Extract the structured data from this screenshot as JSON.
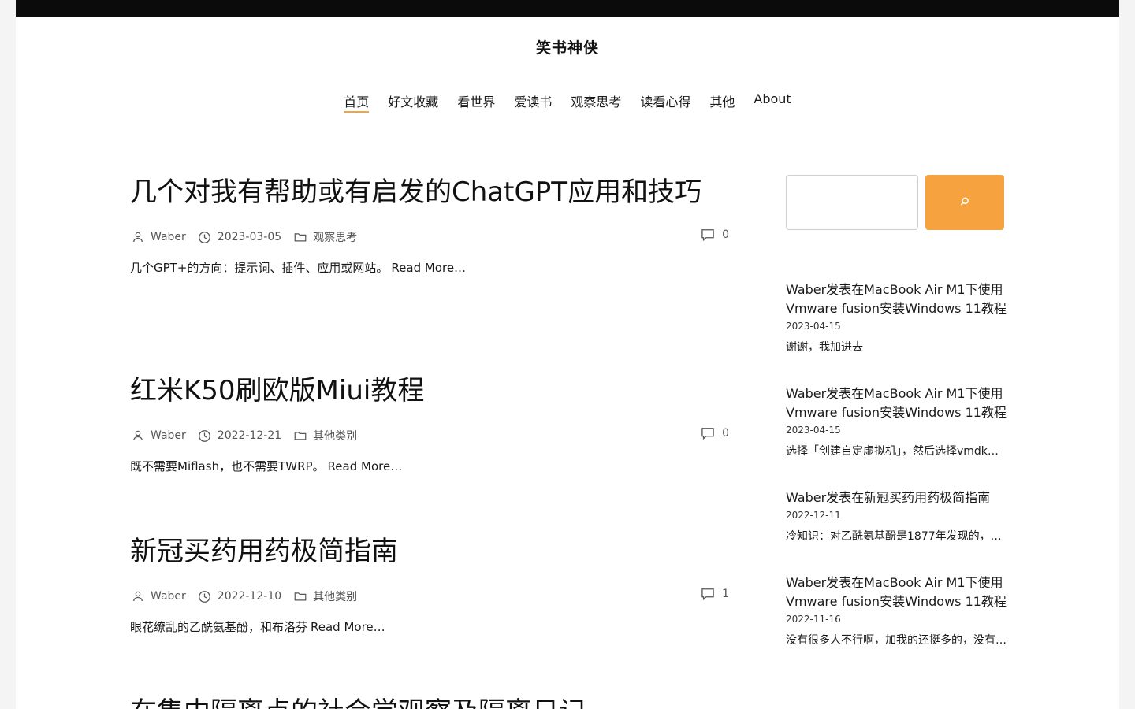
{
  "site": {
    "title": "笑书神侠"
  },
  "nav": [
    {
      "label": "首页",
      "active": true
    },
    {
      "label": "好文收藏"
    },
    {
      "label": "看世界"
    },
    {
      "label": "爱读书"
    },
    {
      "label": "观察思考"
    },
    {
      "label": "读看心得"
    },
    {
      "label": "其他"
    },
    {
      "label": "About"
    }
  ],
  "posts": [
    {
      "title": "几个对我有帮助或有启发的ChatGPT应用和技巧",
      "author": "Waber",
      "date": "2023-03-05",
      "category": "观察思考",
      "comments": "0",
      "excerpt": "几个GPT+的方向：提示词、插件、应用或网站。",
      "read_more": "Read More…"
    },
    {
      "title": "红米K50刷欧版Miui教程",
      "author": "Waber",
      "date": "2022-12-21",
      "category": "其他类别",
      "comments": "0",
      "excerpt": "既不需要Miflash，也不需要TWRP。",
      "read_more": "Read More…"
    },
    {
      "title": "新冠买药用药极简指南",
      "author": "Waber",
      "date": "2022-12-10",
      "category": "其他类别",
      "comments": "1",
      "excerpt": "眼花缭乱的乙酰氨基酚，和布洛芬",
      "read_more": "Read More…"
    },
    {
      "title": "在集中隔离点的社会学观察及隔离日记",
      "author": "",
      "date": "",
      "category": "",
      "comments": "",
      "excerpt": "",
      "read_more": ""
    }
  ],
  "sidebar": {
    "search_placeholder": "",
    "recent_comments": [
      {
        "head": "Waber发表在MacBook Air M1下使用Vmware fusion安装Windows 11教程",
        "date": "2023-04-15",
        "text": "谢谢，我加进去"
      },
      {
        "head": "Waber发表在MacBook Air M1下使用Vmware fusion安装Windows 11教程",
        "date": "2023-04-15",
        "text": "选择「创建自定虚拟机」，然后选择vmdk…"
      },
      {
        "head": "Waber发表在新冠买药用药极简指南",
        "date": "2022-12-11",
        "text": "冷知识：对乙酰氨基酚是1877年发现的，…"
      },
      {
        "head": "Waber发表在MacBook Air M1下使用Vmware fusion安装Windows 11教程",
        "date": "2022-11-16",
        "text": "没有很多人不行啊，加我的还挺多的，没有…"
      }
    ]
  },
  "colors": {
    "accent": "#f6a33f",
    "topbar": "#0b0b0b"
  },
  "icons": {
    "author": "person-icon",
    "date": "clock-icon",
    "category": "folder-icon",
    "comments": "comment-bubble-icon",
    "search": "search-icon"
  }
}
